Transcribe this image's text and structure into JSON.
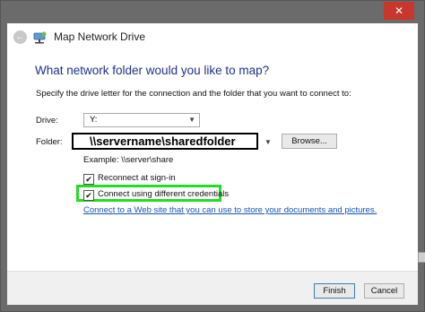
{
  "window": {
    "title": "Map Network Drive",
    "close_label": "✕"
  },
  "wizard": {
    "heading": "What network folder would you like to map?",
    "instruction": "Specify the drive letter for the connection and the folder that you want to connect to:",
    "drive_label": "Drive:",
    "drive_value": "Y:",
    "folder_label": "Folder:",
    "folder_value": "\\\\servername\\sharedfolder",
    "browse_label": "Browse...",
    "example_text": "Example: \\\\server\\share",
    "reconnect_label": "Reconnect at sign-in",
    "reconnect_checked": true,
    "credentials_label": "Connect using different credentials",
    "credentials_checked": true,
    "link_text": "Connect to a Web site that you can use to store your documents and pictures."
  },
  "footer": {
    "finish_label": "Finish",
    "cancel_label": "Cancel"
  },
  "icons": {
    "back": "back-arrow-icon",
    "drive": "network-drive-icon",
    "check": "✔"
  },
  "colors": {
    "heading": "#1e3287",
    "link": "#1555b6",
    "highlight": "#22dd22",
    "close": "#c7372c"
  }
}
